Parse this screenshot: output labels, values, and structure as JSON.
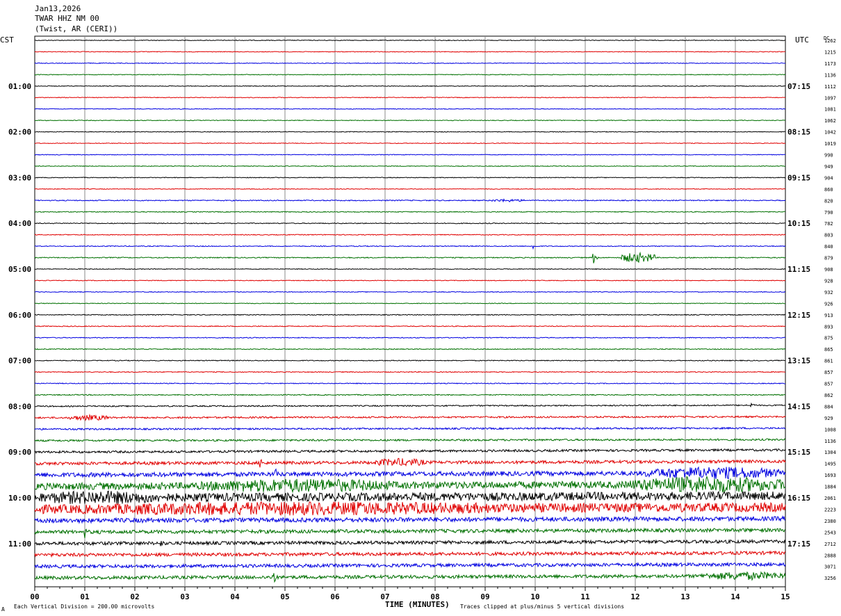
{
  "header": {
    "date": "Jan13,2026",
    "station": "TWAR HHZ NM 00",
    "location": "(Twist, AR (CERI))"
  },
  "labels": {
    "left_tz": "CST",
    "right_tz": "UTC",
    "dc_header": "DC"
  },
  "footer": {
    "scale_note": "Each Vertical Division =  200.00 microvolts",
    "clip_note": "Traces clipped at plus/minus 5 vertical divisions",
    "corner_mark": "A"
  },
  "colors": {
    "trace_cycle": [
      "#000000",
      "#e00000",
      "#0000e0",
      "#007000"
    ],
    "grid": "#888888"
  },
  "chart_data": {
    "type": "line",
    "title": "TWAR HHZ NM 00",
    "xlabel": "TIME (MINUTES)",
    "ylabel": "",
    "xlim": [
      0,
      15
    ],
    "x_ticks": [
      "00",
      "01",
      "02",
      "03",
      "04",
      "05",
      "06",
      "07",
      "08",
      "09",
      "10",
      "11",
      "12",
      "13",
      "14",
      "15"
    ],
    "rows_per_hour": 4,
    "row_count": 48,
    "left_hour_labels": [
      {
        "row": 4,
        "text": "01:00"
      },
      {
        "row": 8,
        "text": "02:00"
      },
      {
        "row": 12,
        "text": "03:00"
      },
      {
        "row": 16,
        "text": "04:00"
      },
      {
        "row": 20,
        "text": "05:00"
      },
      {
        "row": 24,
        "text": "06:00"
      },
      {
        "row": 28,
        "text": "07:00"
      },
      {
        "row": 32,
        "text": "08:00"
      },
      {
        "row": 36,
        "text": "09:00"
      },
      {
        "row": 40,
        "text": "10:00"
      },
      {
        "row": 44,
        "text": "11:00"
      }
    ],
    "right_hour_labels": [
      {
        "row": 4,
        "text": "07:15"
      },
      {
        "row": 8,
        "text": "08:15"
      },
      {
        "row": 12,
        "text": "09:15"
      },
      {
        "row": 16,
        "text": "10:15"
      },
      {
        "row": 20,
        "text": "11:15"
      },
      {
        "row": 24,
        "text": "12:15"
      },
      {
        "row": 28,
        "text": "13:15"
      },
      {
        "row": 32,
        "text": "14:15"
      },
      {
        "row": 36,
        "text": "15:15"
      },
      {
        "row": 40,
        "text": "16:15"
      },
      {
        "row": 44,
        "text": "17:15"
      }
    ],
    "dc_offsets": [
      "1262",
      "1215",
      "1173",
      "1136",
      "1112",
      "1097",
      "1081",
      "1062",
      "1042",
      "1019",
      "990",
      "949",
      "904",
      "860",
      "820",
      "790",
      "782",
      "803",
      "840",
      "879",
      "908",
      "928",
      "932",
      "926",
      "913",
      "893",
      "875",
      "865",
      "861",
      "857",
      "857",
      "862",
      "884",
      "929",
      "1008",
      "1136",
      "1304",
      "1495",
      "1693",
      "1884",
      "2061",
      "2223",
      "2380",
      "2543",
      "2712",
      "2888",
      "3071",
      "3256"
    ],
    "noise_level_by_row": [
      0.5,
      0.5,
      0.5,
      0.5,
      0.5,
      0.5,
      0.5,
      0.5,
      0.5,
      0.5,
      0.5,
      0.5,
      0.5,
      0.5,
      0.7,
      0.6,
      0.6,
      0.6,
      0.6,
      0.7,
      0.5,
      0.5,
      0.5,
      0.5,
      0.6,
      0.6,
      0.6,
      0.6,
      0.6,
      0.6,
      0.6,
      0.7,
      0.9,
      1.2,
      1.2,
      1.3,
      1.6,
      2.2,
      3.2,
      5.0,
      6.0,
      6.5,
      3.2,
      2.6,
      2.4,
      2.4,
      2.4,
      2.4
    ],
    "bursts": [
      {
        "row": 14,
        "start_min": 9.1,
        "end_min": 9.8,
        "amp": 2
      },
      {
        "row": 18,
        "start_min": 9.95,
        "end_min": 10.05,
        "amp": 8
      },
      {
        "row": 19,
        "start_min": 11.15,
        "end_min": 11.3,
        "amp": 12
      },
      {
        "row": 19,
        "start_min": 11.7,
        "end_min": 12.4,
        "amp": 7
      },
      {
        "row": 32,
        "start_min": 14.3,
        "end_min": 14.6,
        "amp": 4
      },
      {
        "row": 33,
        "start_min": 0.7,
        "end_min": 1.5,
        "amp": 4
      },
      {
        "row": 37,
        "start_min": 4.5,
        "end_min": 4.6,
        "amp": 16
      },
      {
        "row": 37,
        "start_min": 6.8,
        "end_min": 7.8,
        "amp": 6
      },
      {
        "row": 38,
        "start_min": 4.8,
        "end_min": 5.0,
        "amp": 10
      },
      {
        "row": 38,
        "start_min": 12.2,
        "end_min": 14.9,
        "amp": 9
      },
      {
        "row": 39,
        "start_min": 3.3,
        "end_min": 7.2,
        "amp": 10
      },
      {
        "row": 39,
        "start_min": 11.9,
        "end_min": 15.0,
        "amp": 12
      },
      {
        "row": 40,
        "start_min": 0.0,
        "end_min": 2.6,
        "amp": 10
      },
      {
        "row": 41,
        "start_min": 0.4,
        "end_min": 10.0,
        "amp": 10
      },
      {
        "row": 43,
        "start_min": 1.0,
        "end_min": 1.2,
        "amp": 10
      },
      {
        "row": 44,
        "start_min": 2.5,
        "end_min": 2.8,
        "amp": 6
      },
      {
        "row": 47,
        "start_min": 4.75,
        "end_min": 4.9,
        "amp": 18
      },
      {
        "row": 47,
        "start_min": 13.3,
        "end_min": 15.0,
        "amp": 6
      }
    ]
  }
}
